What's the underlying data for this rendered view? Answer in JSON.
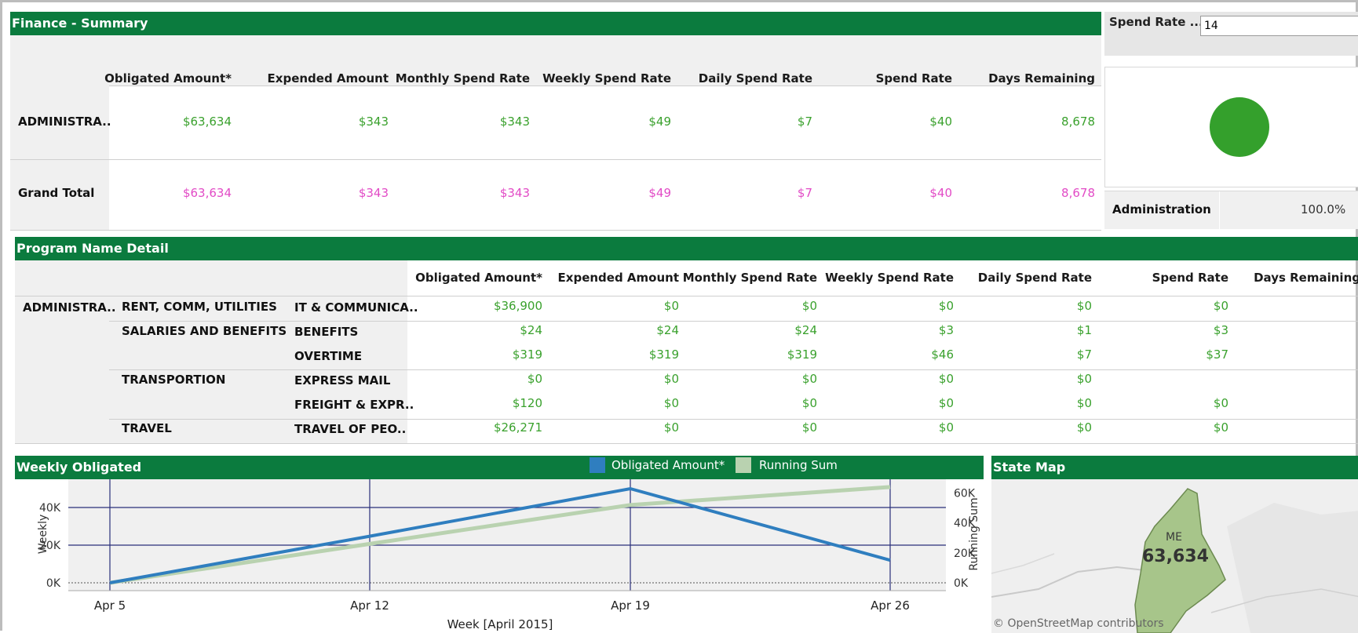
{
  "summary": {
    "title": "Finance - Summary",
    "columns": [
      "Obligated Amount*",
      "Expended Amount",
      "Monthly Spend Rate",
      "Weekly Spend Rate",
      "Daily Spend Rate",
      "Spend Rate",
      "Days Remaining"
    ],
    "rows": [
      {
        "label": "ADMINISTRA..",
        "values": [
          "$63,634",
          "$343",
          "$343",
          "$49",
          "$7",
          "$40",
          "8,678"
        ]
      },
      {
        "label": "Grand Total",
        "values": [
          "$63,634",
          "$343",
          "$343",
          "$49",
          "$7",
          "$40",
          "8,678"
        ]
      }
    ]
  },
  "spend_filter": {
    "label": "Spend Rate ...",
    "value": "14"
  },
  "pie": {
    "category": "Administration",
    "percent": "100.0%",
    "color": "#34a02c"
  },
  "detail": {
    "title": "Program Name Detail",
    "columns": [
      "Obligated Amount*",
      "Expended Amount",
      "Monthly Spend Rate",
      "Weekly Spend Rate",
      "Daily Spend Rate",
      "Spend Rate",
      "Days Remaining"
    ],
    "rows": [
      {
        "c1": "ADMINISTRA..",
        "c2": "RENT, COMM, UTILITIES",
        "c3": "IT & COMMUNICA..",
        "values": [
          "$36,900",
          "$0",
          "$0",
          "$0",
          "$0",
          "$0",
          ""
        ]
      },
      {
        "c1": "",
        "c2": "SALARIES AND BENEFITS",
        "c3": "BENEFITS",
        "values": [
          "$24",
          "$24",
          "$24",
          "$3",
          "$1",
          "$3",
          ""
        ]
      },
      {
        "c1": "",
        "c2": "",
        "c3": "OVERTIME",
        "values": [
          "$319",
          "$319",
          "$319",
          "$46",
          "$7",
          "$37",
          ""
        ]
      },
      {
        "c1": "",
        "c2": "TRANSPORTION",
        "c3": "EXPRESS MAIL",
        "values": [
          "$0",
          "$0",
          "$0",
          "$0",
          "$0",
          "",
          ""
        ]
      },
      {
        "c1": "",
        "c2": "",
        "c3": "FREIGHT & EXPR..",
        "values": [
          "$120",
          "$0",
          "$0",
          "$0",
          "$0",
          "$0",
          ""
        ]
      },
      {
        "c1": "",
        "c2": "TRAVEL",
        "c3": "TRAVEL OF PEO..",
        "values": [
          "$26,271",
          "$0",
          "$0",
          "$0",
          "$0",
          "$0",
          ""
        ]
      }
    ]
  },
  "weekly": {
    "title": "Weekly Obligated",
    "legend": [
      "Obligated Amount*",
      "Running Sum"
    ],
    "y_label": "Weekly",
    "y2_label": "Running Sum",
    "x_label": "Week [April 2015]",
    "y_ticks": [
      "40K",
      "20K",
      "0K"
    ],
    "y2_ticks": [
      "60K",
      "40K",
      "20K",
      "0K"
    ],
    "x_ticks": [
      "Apr 5",
      "Apr 12",
      "Apr 19",
      "Apr 26"
    ],
    "colors": {
      "obligated": "#2f7ebf",
      "running": "#b9d2b0"
    }
  },
  "chart_data": {
    "type": "line",
    "x": [
      "Apr 5",
      "Apr 12",
      "Apr 19",
      "Apr 26"
    ],
    "series": [
      {
        "name": "Obligated Amount*",
        "values": [
          0,
          24743,
          50000,
          12000
        ]
      },
      {
        "name": "Running Sum",
        "values": [
          0,
          26000,
          52000,
          64000
        ]
      }
    ],
    "ylim": [
      0,
      50000
    ],
    "y2lim": [
      0,
      65000
    ],
    "xlabel": "Week [April 2015]",
    "ylabel": "Weekly",
    "y2label": "Running Sum"
  },
  "map": {
    "title": "State Map",
    "state": "ME",
    "value": "63,634",
    "attribution": "© OpenStreetMap contributors",
    "fill": "#a7c58a"
  }
}
